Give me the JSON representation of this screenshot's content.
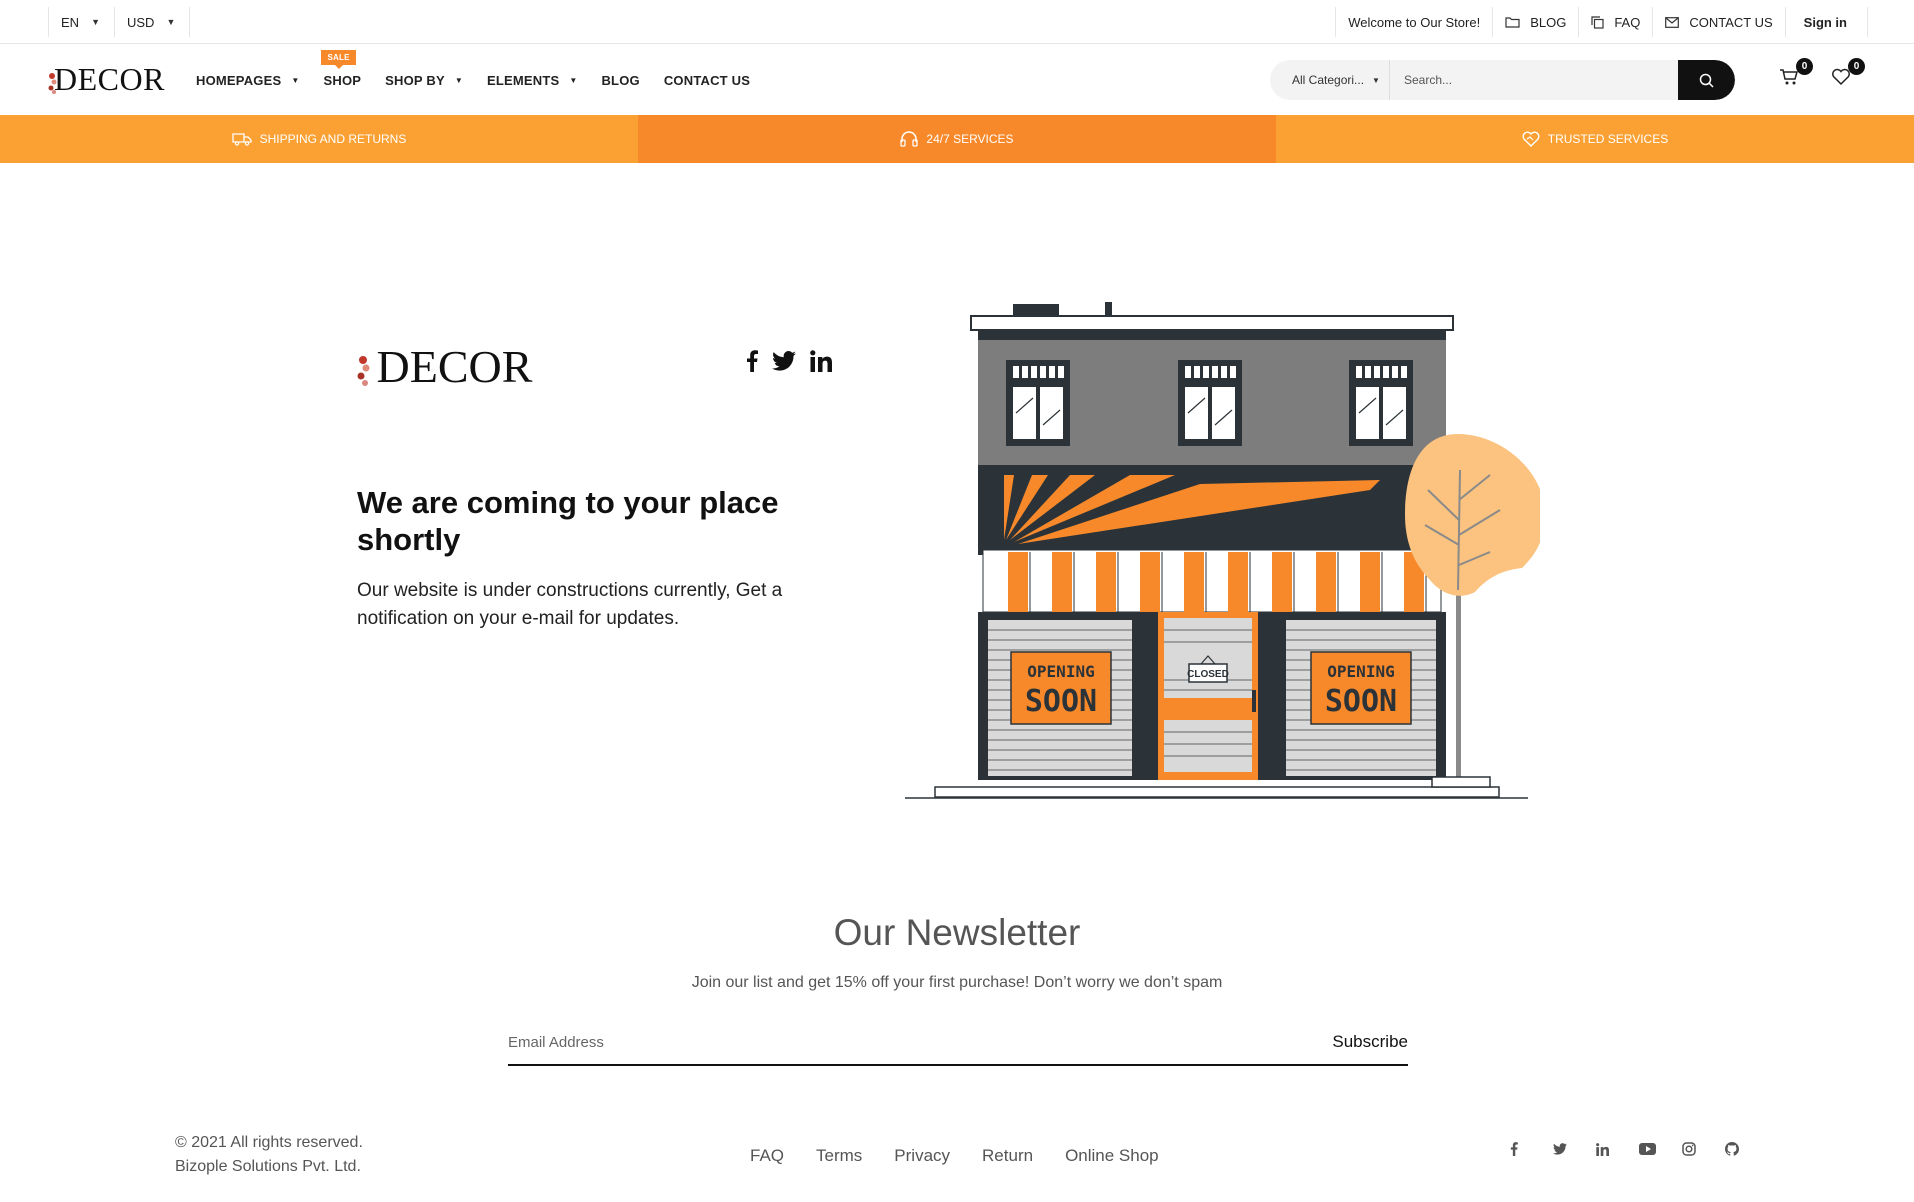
{
  "topbar": {
    "language": "EN",
    "currency": "USD",
    "welcome": "Welcome to Our Store!",
    "blog": "BLOG",
    "faq": "FAQ",
    "contact": "CONTACT US",
    "signin": "Sign in"
  },
  "header": {
    "logo": "DECOR",
    "nav": [
      {
        "label": "HOMEPAGES",
        "dropdown": true
      },
      {
        "label": "SHOP",
        "dropdown": false,
        "badge": "SALE"
      },
      {
        "label": "SHOP BY",
        "dropdown": true
      },
      {
        "label": "ELEMENTS",
        "dropdown": true
      },
      {
        "label": "BLOG",
        "dropdown": false
      },
      {
        "label": "CONTACT US",
        "dropdown": false
      }
    ],
    "category": "All Categori...",
    "search_placeholder": "Search...",
    "cart_count": "0",
    "wishlist_count": "0"
  },
  "strip": {
    "shipping": "SHIPPING AND RETURNS",
    "services": "24/7 SERVICES",
    "trusted": "TRUSTED SERVICES"
  },
  "main": {
    "logo": "DECOR",
    "headline": "We are coming to your place shortly",
    "subtext": "Our website is under constructions currently, Get a notification on your e-mail for updates.",
    "sign_left_1": "OPENING",
    "sign_left_2": "SOON",
    "sign_right_1": "OPENING",
    "sign_right_2": "SOON",
    "door_sign": "CLOSED"
  },
  "newsletter": {
    "title": "Our Newsletter",
    "subtitle": "Join our list and get 15% off your first purchase! Don’t worry we don’t spam",
    "placeholder": "Email Address",
    "button": "Subscribe"
  },
  "footer": {
    "copy_line1": "© 2021 All rights reserved.",
    "copy_line2": "Bizople Solutions Pvt. Ltd.",
    "links": [
      "FAQ",
      "Terms",
      "Privacy",
      "Return",
      "Online Shop"
    ]
  },
  "colors": {
    "orange": "#f7892a",
    "light_orange": "#fba134",
    "dark": "#2b3338"
  }
}
